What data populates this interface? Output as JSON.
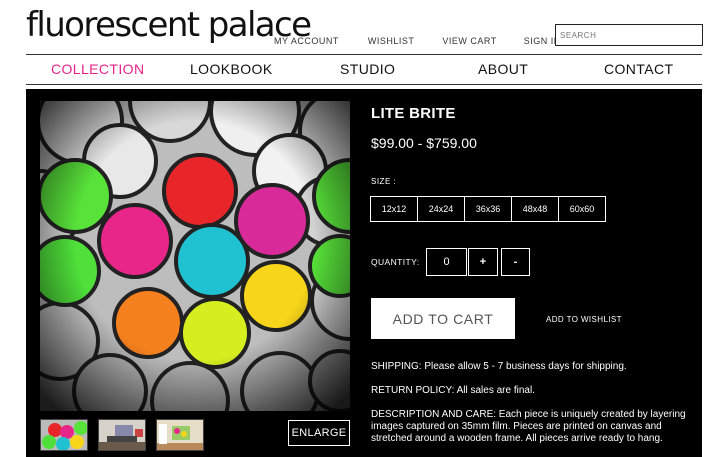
{
  "header": {
    "logo": "fluorescent palace",
    "links": [
      "MY ACCOUNT",
      "WISHLIST",
      "VIEW CART",
      "SIGN IN"
    ],
    "search_placeholder": "SEARCH"
  },
  "nav": {
    "items": [
      "COLLECTION",
      "LOOKBOOK",
      "STUDIO",
      "ABOUT",
      "CONTACT"
    ],
    "active": "COLLECTION"
  },
  "product": {
    "title": "LITE BRITE",
    "price": "$99.00 - $759.00",
    "size_label": "SIZE :",
    "sizes": [
      "12x12",
      "24x24",
      "36x36",
      "48x48",
      "60x60"
    ],
    "quantity_label": "QUANTITY:",
    "quantity_value": "0",
    "plus_label": "+",
    "minus_label": "-",
    "add_to_cart": "ADD TO CART",
    "add_to_wishlist": "ADD TO WISHLIST",
    "shipping": "SHIPPING:  Please allow 5 - 7 business days for shipping.",
    "return_policy": "RETURN POLICY:  All sales are final.",
    "description": "DESCRIPTION AND CARE:  Each piece is uniquely created by layering images captured on 35mm film. Pieces are printed on canvas and stretched around a wooden frame. All pieces arrive ready to hang.",
    "enlarge": "ENLARGE"
  },
  "colors": {
    "accent_pink": "#e8248a",
    "panel_bg": "#000000"
  }
}
